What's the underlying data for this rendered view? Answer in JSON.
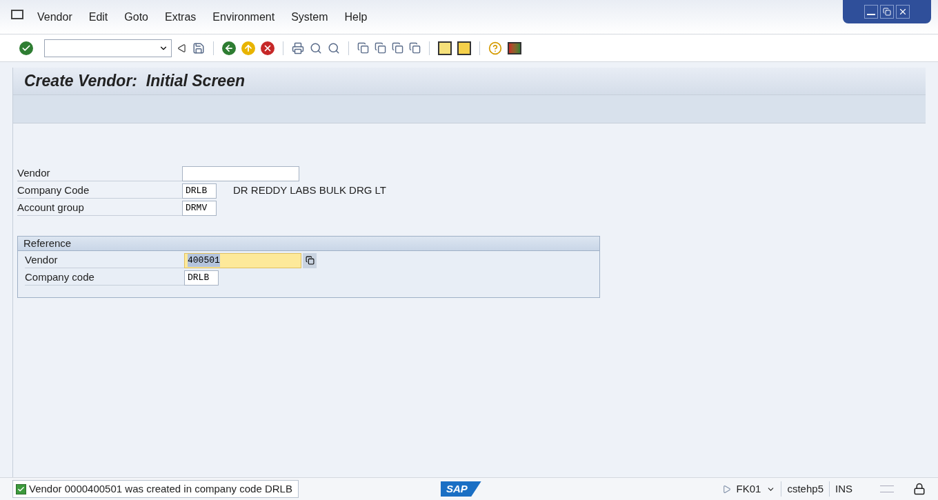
{
  "menu": [
    "Vendor",
    "Edit",
    "Goto",
    "Extras",
    "Environment",
    "System",
    "Help"
  ],
  "title": "Create Vendor:  Initial Screen",
  "fields": [
    {
      "label": "Vendor",
      "kind": "long",
      "focused": false
    },
    {
      "label": "Company Code",
      "value": "DRLB",
      "kind": "short",
      "focused": false,
      "description": "DR REDDY LABS BULK DRG LT"
    },
    {
      "label": "Account group",
      "value": "DRMV",
      "kind": "short",
      "focused": false
    }
  ],
  "reference": {
    "title": "Reference",
    "fields": [
      {
        "label": "Vendor",
        "value": "400501",
        "kind": "long",
        "focused": true
      },
      {
        "label": "Company code",
        "value": "DRLB",
        "kind": "short",
        "focused": false
      }
    ]
  },
  "status_bar": {
    "message": "Vendor 0000400501 was created in company code DRLB",
    "logo": "SAP",
    "transaction": "FK01",
    "server": "cstehp5",
    "mode": "INS"
  }
}
